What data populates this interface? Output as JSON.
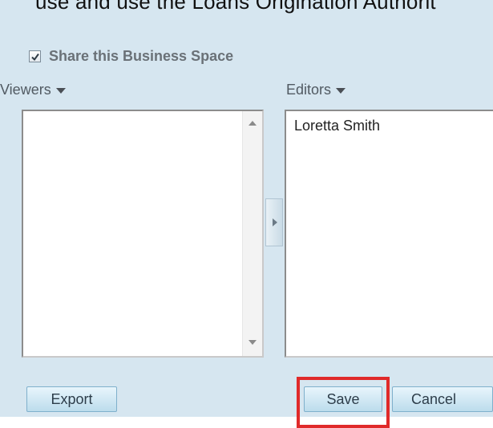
{
  "header": {
    "cut_text": "use and use the  Loans Origination Authorit"
  },
  "share": {
    "checked": true,
    "label": "Share this Business Space"
  },
  "viewers": {
    "label": "Viewers",
    "items": []
  },
  "editors": {
    "label": "Editors",
    "items": [
      "Loretta Smith"
    ]
  },
  "buttons": {
    "export": "Export",
    "save": "Save",
    "cancel": "Cancel"
  },
  "colors": {
    "panel_bg": "#d6e6f0",
    "highlight": "#e02a2a"
  },
  "icons": {
    "checkbox": "checkmark-icon",
    "dropdown": "caret-down-icon",
    "move_right": "arrow-right-icon",
    "scroll_up": "scroll-up-icon",
    "scroll_down": "scroll-down-icon"
  }
}
